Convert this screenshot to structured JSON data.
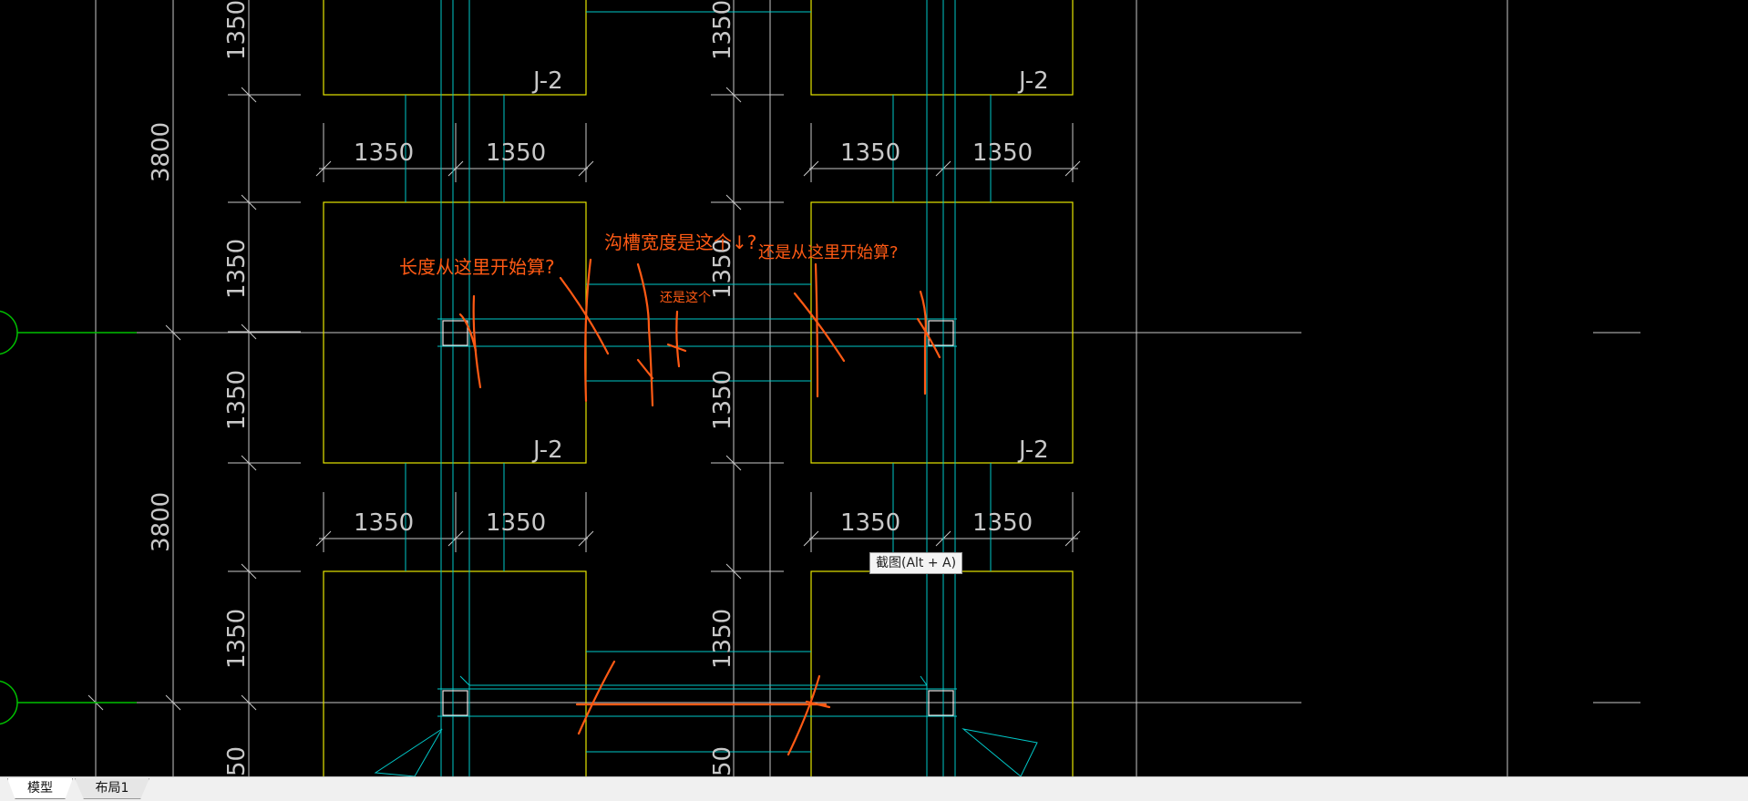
{
  "drawing": {
    "dim_1350": "1350",
    "dim_3800": "3800",
    "footing_tag": "J-2",
    "partial_dim": "50",
    "annotations": {
      "length_start": "长度从这里开始算?",
      "trench_width": "沟槽宽度是这个↓?",
      "or_this": "还是这个",
      "or_start_here": "还是从这里开始算?"
    },
    "colors": {
      "background": "#000000",
      "dim_lines": "#c8c8c8",
      "footing": "#e6e600",
      "beam": "#00c8c8",
      "axis": "#00c000",
      "markup": "#ff5a14"
    }
  },
  "tooltip": "截图(Alt + A)",
  "tabs": [
    {
      "label": "模型"
    },
    {
      "label": "布局1"
    }
  ]
}
